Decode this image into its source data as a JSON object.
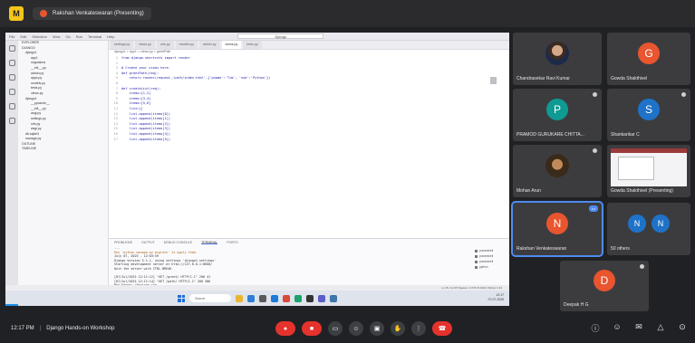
{
  "meeting": {
    "presenter_label": "Rakshan Venkateswaran (Presenting)",
    "time": "12:17 PM",
    "title": "Django Hands-on Workshop",
    "colors": {
      "background": "#202124",
      "tile": "#3c3c3f",
      "end_call": "#e5322d",
      "accent": "#4f8bf0"
    }
  },
  "ide": {
    "title_items": [
      "File",
      "Edit",
      "Selection",
      "View",
      "Go",
      "Run",
      "Terminal",
      "Help"
    ],
    "search_text": "Django",
    "tabs": [
      "settings.py",
      "views.py",
      "urls.py",
      "models.py",
      "admin.py",
      "views.py",
      "tests.py"
    ],
    "breadcrumb": "django1 > app1 > views.py > greetPath",
    "explorer_lines": [
      "EXPLORER",
      "DJANGO",
      "django1",
      "app1",
      "migrations",
      "__init__.py",
      "admin.py",
      "apps.py",
      "models.py",
      "tests.py",
      "views.py",
      "django1",
      "__pycache__",
      "__init__.py",
      "asgi.py",
      "settings.py",
      "urls.py",
      "wsgi.py",
      "db.sqlite3",
      "manage.py",
      "OUTLINE",
      "TIMELINE"
    ],
    "code_lines": [
      "from django.shortcuts import render",
      "",
      "# Create your views here.",
      "def greetPath(req):",
      "    return render(request,'path/index.html',{'pname':'Tim', 'sub':'Python'})",
      "",
      "def createList(req):",
      "    items=[1,2]",
      "    items=[3,4]",
      "    items=[5,6]",
      "    list=[]",
      "    list.append(items[0])",
      "    list.append(items[1])",
      "    list.append(items[2])",
      "    list.append(items[3])",
      "    list.append(items[4])",
      "    list.append(items[5])"
    ],
    "panel_tabs": [
      "PROBLEMS",
      "OUTPUT",
      "DEBUG CONSOLE",
      "TERMINAL",
      "PORTS"
    ],
    "terminal_lines": [
      "...",
      "Run 'python manage.py migrate' to apply them.",
      "July 07, 2025 - 12:03:59",
      "Django version 5.1.1, using settings 'django1.settings'",
      "Starting development server at http://127.0.0.1:8000/",
      "Quit the server with CTRL-BREAK.",
      "",
      "[07/Jul/2025 12:11:12] \"GET /greet/ HTTP/1.1\" 200 41",
      "[07/Jul/2025 12:11:14] \"GET /path/ HTTP/1.1\" 200 386",
      "Not Found: /favicon.ico",
      "[07/Jul/2025 12:14:02] \"GET /list/ HTTP/1.1\" 200 132"
    ],
    "terminal_list": [
      "powershell",
      "powershell",
      "powershell",
      "python"
    ],
    "taskbar_search": "Search",
    "clock": [
      "12:17",
      "07-07-2025"
    ],
    "status_text": "Ln 15, Col 25  Spaces: 4  UTF-8  CRLF  Python  3.12"
  },
  "participants": [
    {
      "name": "Chandrasekar Ravi Kumar",
      "type": "photo"
    },
    {
      "name": "Gowda Shakthivel",
      "type": "avatar",
      "initial": "G",
      "color": "#e8552f"
    },
    {
      "name": "PRAMOD GURUKARE CHITTA...",
      "type": "avatar",
      "initial": "P",
      "color": "#0f9a93"
    },
    {
      "name": "Shankarikar C",
      "type": "avatar",
      "initial": "S",
      "color": "#1e73c8"
    },
    {
      "name": "Mohan Arun",
      "type": "photo"
    },
    {
      "name": "Gowda Shakthivel (Presenting)",
      "type": "screen"
    },
    {
      "name": "Rakshan Venkateswaran",
      "type": "avatar",
      "initial": "N",
      "color": "#e8552f"
    },
    {
      "name": "50 others",
      "type": "group",
      "initials": [
        "N",
        "N"
      ]
    },
    {
      "name": "Deepak H G",
      "type": "avatar",
      "initial": "D",
      "color": "#e8552f"
    }
  ]
}
